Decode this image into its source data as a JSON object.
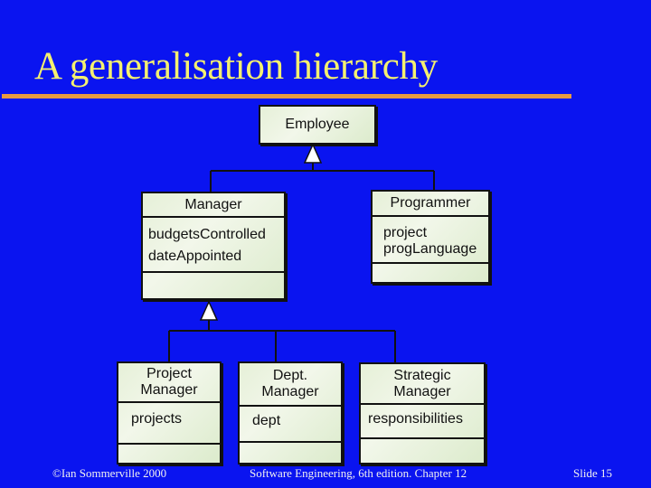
{
  "slide": {
    "title": "A generalisation hierarchy",
    "colors": {
      "background": "#0a14f0",
      "title": "#f4f070",
      "rule": "#e89a40",
      "class_fill": "#e6f0d8"
    }
  },
  "diagram": {
    "classes": {
      "employee": {
        "name": "Employee",
        "attributes": []
      },
      "manager": {
        "name": "Manager",
        "attributes": [
          "budgetsControlled",
          "dateAppointed"
        ]
      },
      "programmer": {
        "name": "Programmer",
        "attributes": [
          "project",
          "progLanguage"
        ]
      },
      "project_manager": {
        "name_lines": [
          "Project",
          "Manager"
        ],
        "attributes": [
          "projects"
        ]
      },
      "dept_manager": {
        "name_lines": [
          "Dept.",
          "Manager"
        ],
        "attributes": [
          "dept"
        ]
      },
      "strategic_manager": {
        "name_lines": [
          "Strategic",
          "Manager"
        ],
        "attributes": [
          "responsibilities"
        ]
      }
    },
    "relationships": [
      {
        "type": "generalisation",
        "parent": "Employee",
        "children": [
          "Manager",
          "Programmer"
        ]
      },
      {
        "type": "generalisation",
        "parent": "Manager",
        "children": [
          "Project Manager",
          "Dept. Manager",
          "Strategic Manager"
        ]
      }
    ]
  },
  "footer": {
    "copyright": "©Ian Sommerville 2000",
    "book": "Software Engineering, 6th edition. Chapter 12",
    "slide_number": "Slide 15"
  }
}
